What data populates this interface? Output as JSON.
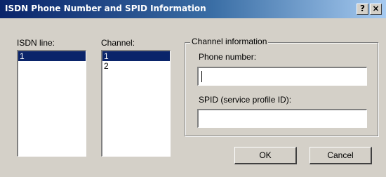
{
  "window": {
    "title": "ISDN Phone Number and SPID Information",
    "help_button": "?",
    "close_button": "×"
  },
  "isdn_line": {
    "label": "ISDN line:",
    "items": [
      "1"
    ],
    "selected": "1"
  },
  "channel": {
    "label": "Channel:",
    "items": [
      "1",
      "2"
    ],
    "selected": "1"
  },
  "channel_info": {
    "group_title": "Channel information",
    "phone_label": "Phone number:",
    "phone_value": "",
    "spid_label": "SPID (service profile ID):",
    "spid_value": ""
  },
  "buttons": {
    "ok": "OK",
    "cancel": "Cancel"
  },
  "colors": {
    "title_start": "#0a246a",
    "title_end": "#a6caf0",
    "selection": "#0a246a",
    "face": "#d4d0c8"
  }
}
